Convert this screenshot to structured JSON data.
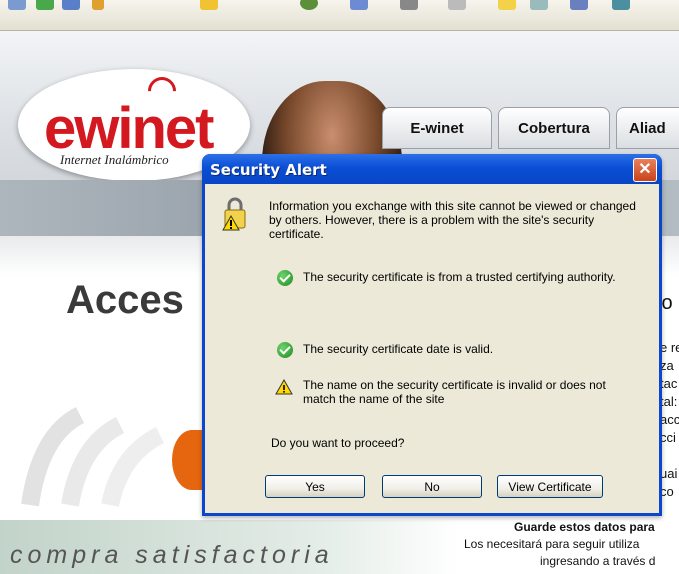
{
  "header": {
    "logo_text": "ewinet",
    "logo_subtitle": "Internet Inalámbrico",
    "nav_tabs": [
      "E-winet",
      "Cobertura",
      "Aliad"
    ]
  },
  "main": {
    "title_fragment": "Acces",
    "side_fragments": [
      "to",
      "e re",
      "za",
      "tac",
      "tal:",
      "acc",
      "cci",
      "uai",
      "co"
    ],
    "slogan": "compra satisfactoria",
    "guarde_text": "Guarde estos datos para",
    "footer_line_1": "Los necesitará para seguir utiliza",
    "footer_line_2": "ingresando a través d"
  },
  "dialog": {
    "title": "Security Alert",
    "intro": "Information you exchange with this site cannot be viewed or changed by others. However, there is a problem with the site's security certificate.",
    "items": [
      {
        "icon": "check-icon",
        "text": "The security certificate is from a trusted certifying authority."
      },
      {
        "icon": "check-icon",
        "text": "The security certificate date is valid."
      },
      {
        "icon": "warning-icon",
        "text": "The name on the security certificate is invalid or does not match the name of the site"
      }
    ],
    "question": "Do you want to proceed?",
    "buttons": {
      "yes": "Yes",
      "no": "No",
      "view": "View Certificate"
    }
  },
  "colors": {
    "brand_red": "#d3181f",
    "titlebar_blue": "#0a4fd6",
    "dialog_face": "#ece9d8",
    "accent_orange": "#e6660f"
  }
}
